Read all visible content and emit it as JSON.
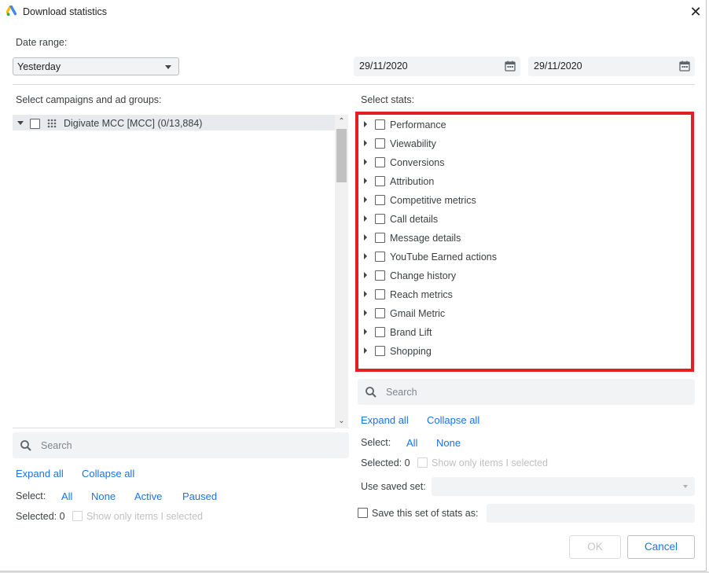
{
  "window": {
    "title": "Download statistics",
    "close_icon": "close-icon"
  },
  "date_range": {
    "label": "Date range:",
    "selected": "Yesterday",
    "start_date": "29/11/2020",
    "end_date": "29/11/2020"
  },
  "campaigns": {
    "label": "Select campaigns and ad groups:",
    "tree_item": "Digivate MCC [MCC] (0/13,884)",
    "search_placeholder": "Search",
    "expand_all": "Expand all",
    "collapse_all": "Collapse all",
    "select_label": "Select:",
    "select_options": [
      "All",
      "None",
      "Active",
      "Paused"
    ],
    "selected_count": "Selected: 0",
    "show_only_selected": "Show only items I selected"
  },
  "stats": {
    "label": "Select stats:",
    "items": [
      "Performance",
      "Viewability",
      "Conversions",
      "Attribution",
      "Competitive metrics",
      "Call details",
      "Message details",
      "YouTube Earned actions",
      "Change history",
      "Reach metrics",
      "Gmail Metric",
      "Brand Lift",
      "Shopping"
    ],
    "search_placeholder": "Search",
    "expand_all": "Expand all",
    "collapse_all": "Collapse all",
    "select_label": "Select:",
    "select_options": [
      "All",
      "None"
    ],
    "selected_count": "Selected: 0",
    "show_only_selected": "Show only items I selected",
    "use_saved_set_label": "Use saved set:",
    "save_set_label": "Save this set of stats as:",
    "highlight_color": "#e31e24"
  },
  "buttons": {
    "ok": "OK",
    "cancel": "Cancel"
  },
  "colors": {
    "link": "#1a73e8",
    "field_bg": "#f1f3f4"
  }
}
